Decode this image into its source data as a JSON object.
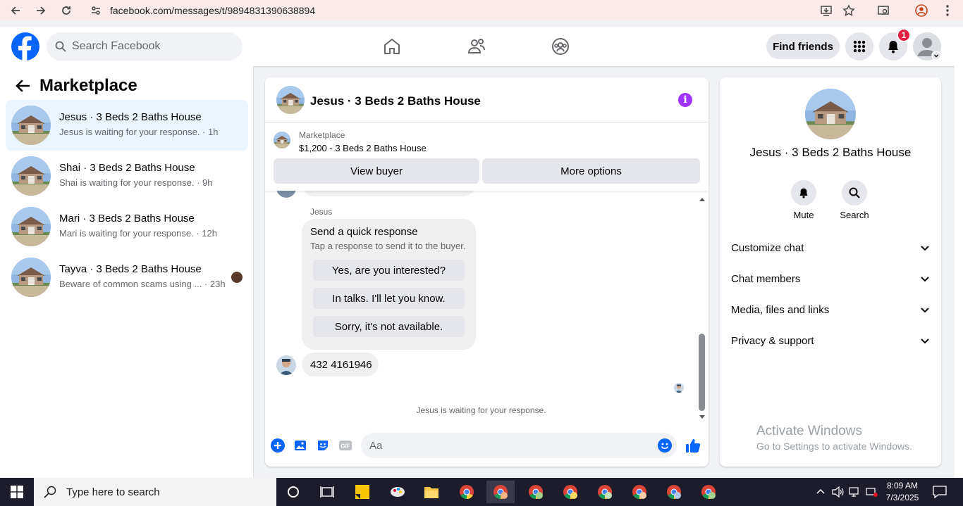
{
  "browser": {
    "url": "facebook.com/messages/t/9894831390638894"
  },
  "header": {
    "search_placeholder": "Search Facebook",
    "find_friends": "Find friends",
    "notification_count": "1"
  },
  "sidebar": {
    "title": "Marketplace",
    "conversations": [
      {
        "name": "Jesus · 3 Beds 2 Baths House",
        "preview": "Jesus is waiting for your response. · 1h",
        "active": true
      },
      {
        "name": "Shai · 3 Beds 2 Baths House",
        "preview": "Shai is waiting for your response. · 9h",
        "active": false
      },
      {
        "name": "Mari · 3 Beds 2 Baths House",
        "preview": "Mari is waiting for your response. · 12h",
        "active": false
      },
      {
        "name": "Tayva · 3 Beds 2 Baths House",
        "preview": "Beware of common scams using ...  · 23h",
        "active": false
      }
    ]
  },
  "chat": {
    "title": "Jesus · 3 Beds 2 Baths House",
    "listing_kicker": "Marketplace",
    "listing_price": "$1,200 - 3 Beds 2 Baths House",
    "view_buyer": "View buyer",
    "more_options": "More options",
    "sender_label": "Jesus",
    "quick_title": "Send a quick response",
    "quick_sub": "Tap a response to send it to the buyer.",
    "quick_replies": [
      "Yes, are you interested?",
      "In talks. I'll let you know.",
      "Sorry, it's not available."
    ],
    "phone_message": "432 4161946",
    "waiting_note": "Jesus is waiting for your response.",
    "input_placeholder": "Aa"
  },
  "details": {
    "title": "Jesus · 3 Beds 2 Baths House",
    "mute": "Mute",
    "search": "Search",
    "rows": [
      "Customize chat",
      "Chat members",
      "Media, files and links",
      "Privacy & support"
    ]
  },
  "watermark": {
    "line1": "Activate Windows",
    "line2": "Go to Settings to activate Windows."
  },
  "taskbar": {
    "search_placeholder": "Type here to search",
    "time": "8:09 AM",
    "date": "7/3/2025"
  },
  "colors": {
    "fb_blue": "#0866ff",
    "active_conv": "#ebf5ff",
    "info_purple": "#a033ff",
    "badge_red": "#e41e3f"
  }
}
